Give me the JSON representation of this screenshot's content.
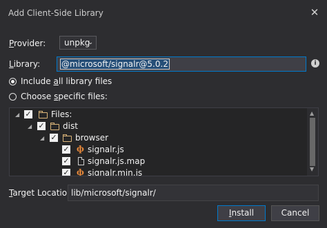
{
  "dialog": {
    "title": "Add Client-Side Library"
  },
  "provider": {
    "label_prefix": "P",
    "label_rest": "rovider:",
    "selected": "unpkg"
  },
  "library": {
    "label_prefix": "L",
    "label_rest": "ibrary:",
    "value": "@microsoft/signalr@5.0.2"
  },
  "options": {
    "include_all_pre": "Include ",
    "include_all_acc": "a",
    "include_all_post": "ll library files",
    "choose_specific_pre": "Choose ",
    "choose_specific_acc": "s",
    "choose_specific_post": "pecific files:",
    "selected_option": "include_all"
  },
  "tree": {
    "items": [
      {
        "label": "Files:",
        "kind": "folder",
        "checked": true
      },
      {
        "label": "dist",
        "kind": "folder",
        "checked": true
      },
      {
        "label": "browser",
        "kind": "folder",
        "checked": true
      },
      {
        "label": "signalr.js",
        "kind": "js-file",
        "checked": true
      },
      {
        "label": "signalr.js.map",
        "kind": "file",
        "checked": true
      },
      {
        "label": "signalr.min.js",
        "kind": "js-file",
        "checked": true
      }
    ]
  },
  "target": {
    "label_prefix": "T",
    "label_rest": "arget Location:",
    "value": "lib/microsoft/signalr/"
  },
  "buttons": {
    "install_prefix": "I",
    "install_rest": "nstall",
    "cancel": "Cancel"
  },
  "colors": {
    "background": "#2d2d30",
    "accent": "#007acc",
    "folder": "#dcb67a",
    "js_icon": "#e5883b"
  }
}
